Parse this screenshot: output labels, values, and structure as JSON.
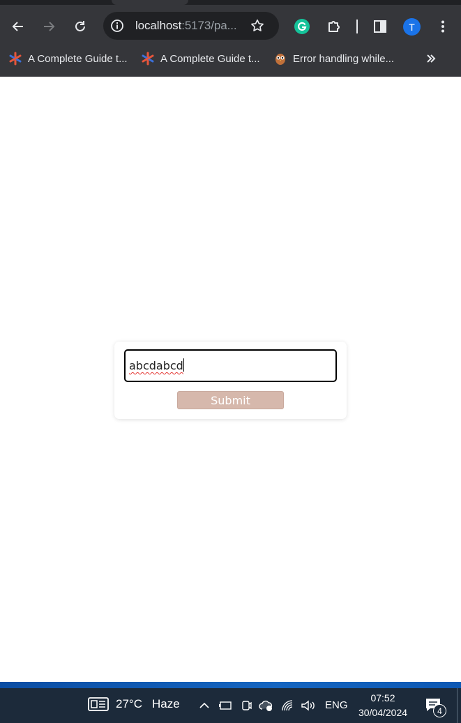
{
  "browser": {
    "address_bar": {
      "host": "localhost",
      "rest": ":5173/pa..."
    },
    "profile_initial": "T",
    "bookmarks": [
      {
        "label": "A Complete Guide t...",
        "icon": "asterisk-favicon"
      },
      {
        "label": "A Complete Guide t...",
        "icon": "asterisk-favicon"
      },
      {
        "label": "Error handling while...",
        "icon": "owl-favicon"
      }
    ]
  },
  "form": {
    "input_value": "abcdabcd",
    "submit_label": "Submit",
    "submit_color": "#d6b8ac"
  },
  "taskbar": {
    "temperature": "27°C",
    "condition": "Haze",
    "language": "ENG",
    "time": "07:52",
    "date": "30/04/2024",
    "notification_count": "4"
  }
}
